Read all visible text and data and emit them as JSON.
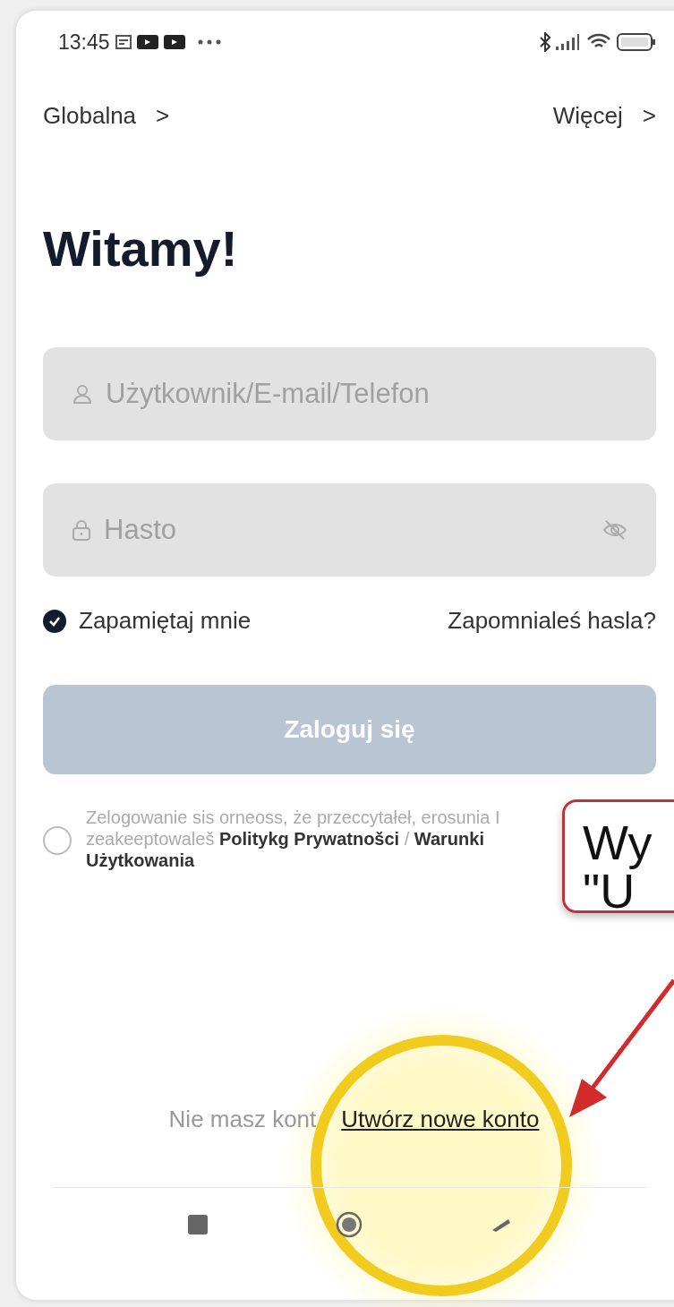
{
  "status_bar": {
    "time": "13:45"
  },
  "top_nav": {
    "left": "Globalna",
    "left_chevron": ">",
    "right": "Więcej",
    "right_chevron": ">"
  },
  "title": "Witamy!",
  "fields": [
    {
      "kind": "user",
      "placeholder": "Użytkownik/E-mail/Telefon"
    },
    {
      "kind": "password",
      "placeholder": "Hasto"
    }
  ],
  "remember": {
    "label": "Zapamiętaj mnie",
    "checked": true
  },
  "forgot_link": "Zapomnialeś hasla?",
  "login_button": {
    "label": "Zaloguj się",
    "disabled": true
  },
  "terms": {
    "checked": false,
    "text": "Zelogowanie sis orneoss, że przeccytałeł, erosunia I zeakeeptowaleš **Politykg Prywatnošci** / **Warunki Użytkowania**"
  },
  "signup": {
    "prompt": "Nie masz kont",
    "link": "Utwórz nowe konto"
  },
  "callout": {
    "lines": [
      "Wy",
      "\"U"
    ]
  }
}
